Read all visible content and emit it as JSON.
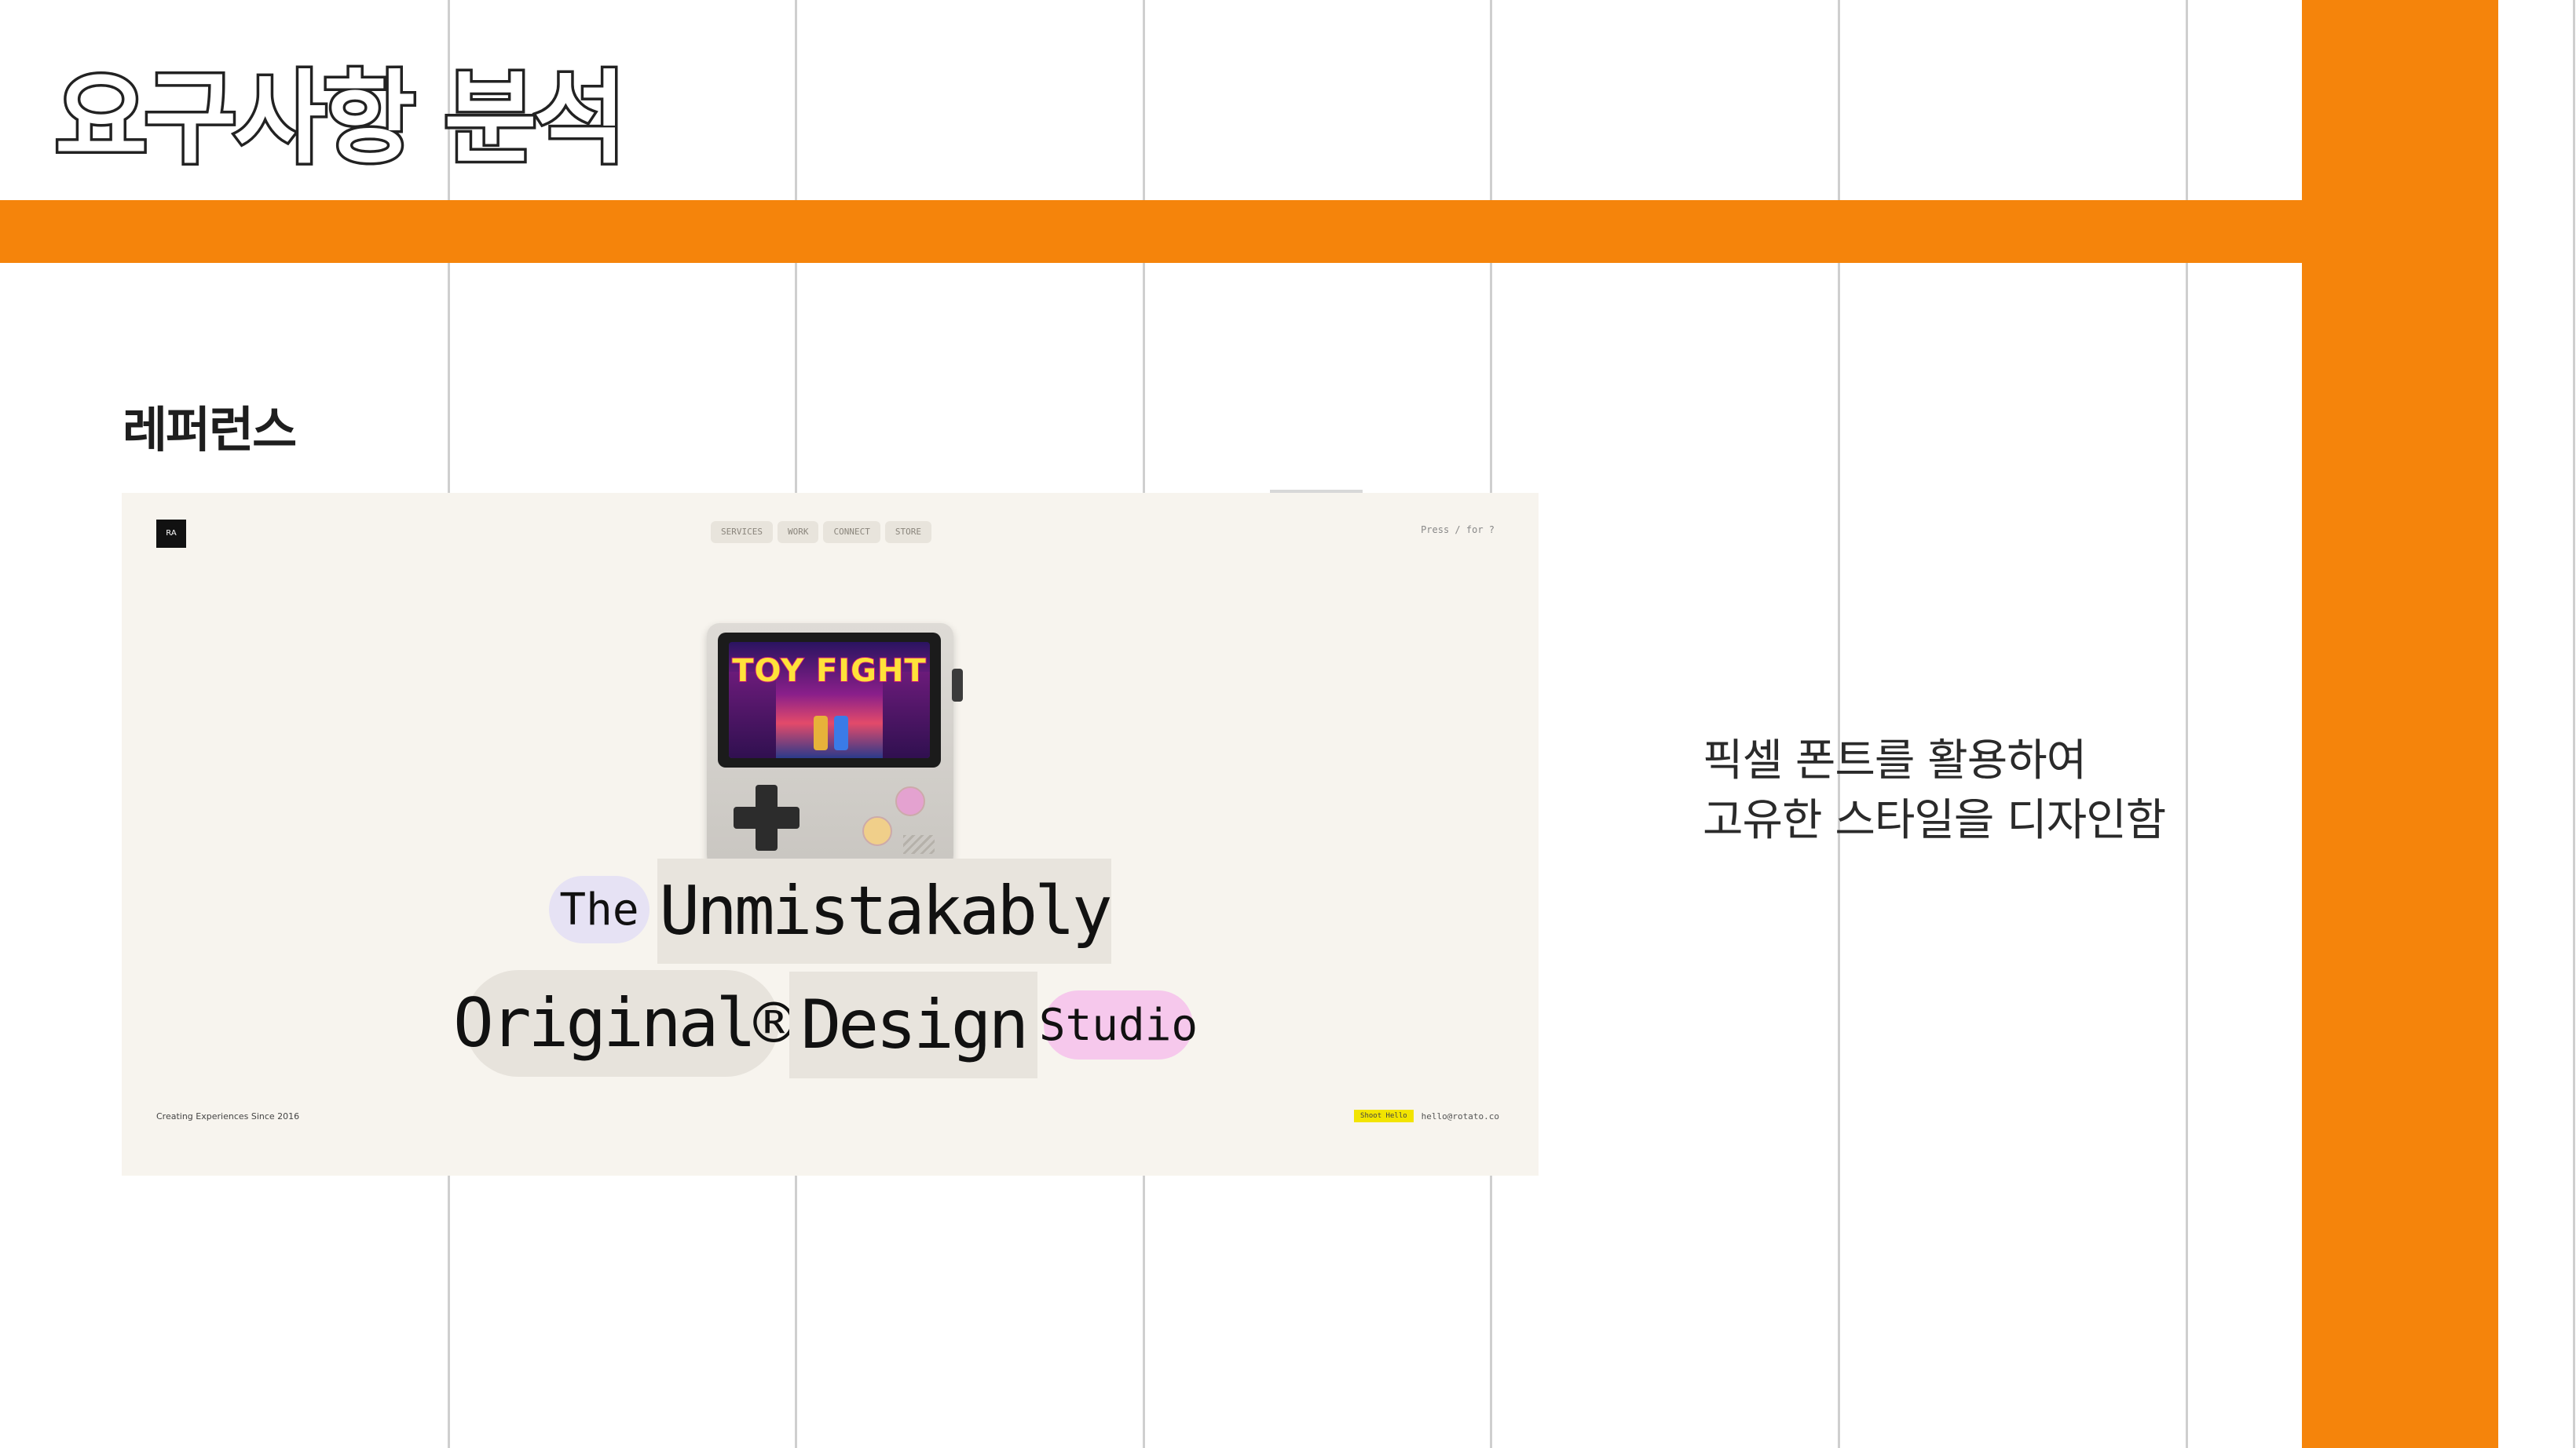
{
  "slide": {
    "title": "요구사항 분석",
    "section_label": "레퍼런스",
    "description_lines": [
      "픽셀 폰트를 활용하여",
      "고유한 스타일을 디자인함"
    ],
    "colors": {
      "accent": "#F5840B",
      "background": "#FFFFFF",
      "grid_line": "#CFCFCF"
    }
  },
  "reference": {
    "logo_text": "RA",
    "nav": [
      "SERVICES",
      "WORK",
      "CONNECT",
      "STORE"
    ],
    "corner_text": "Press / for ?",
    "hero": {
      "the": "The",
      "unmistakably": "Unmistakably",
      "original": "Original®",
      "design": "Design",
      "studio": "Studio"
    },
    "console_screen_title": "TOY FIGHT",
    "footer_left": "Creating Experiences Since 2016",
    "footer_tag": "Shoot Hello",
    "footer_email": "hello@rotato.co",
    "colors": {
      "card_bg": "#F7F4EE",
      "pill_purple": "#E6E2F4",
      "pill_pink": "#F6C8EC",
      "footer_tag": "#F2E400"
    }
  }
}
